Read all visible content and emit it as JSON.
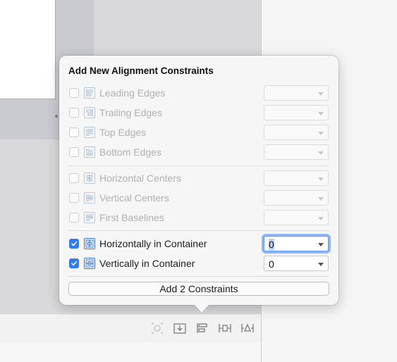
{
  "popover": {
    "title": "Add New Alignment Constraints",
    "add_button_label": "Add 2 Constraints",
    "groups": [
      [
        {
          "label": "Leading Edges",
          "checked": false,
          "icon": "leading-edges-icon"
        },
        {
          "label": "Trailing Edges",
          "checked": false,
          "icon": "trailing-edges-icon"
        },
        {
          "label": "Top Edges",
          "checked": false,
          "icon": "top-edges-icon"
        },
        {
          "label": "Bottom Edges",
          "checked": false,
          "icon": "bottom-edges-icon"
        }
      ],
      [
        {
          "label": "Horizontal Centers",
          "checked": false,
          "icon": "horizontal-centers-icon"
        },
        {
          "label": "Vertical Centers",
          "checked": false,
          "icon": "vertical-centers-icon"
        },
        {
          "label": "First Baselines",
          "checked": false,
          "icon": "first-baselines-icon"
        }
      ],
      [
        {
          "label": "Horizontally in Container",
          "checked": true,
          "icon": "horizontally-in-container-icon",
          "value": "0"
        },
        {
          "label": "Vertically in Container",
          "checked": true,
          "icon": "vertically-in-container-icon",
          "value": "0"
        }
      ]
    ]
  },
  "toolbar": {
    "icons": [
      "update-frames-icon",
      "embed-in-icon",
      "align-icon",
      "add-new-constraints-icon",
      "resolve-issues-icon"
    ]
  },
  "colors": {
    "accent": "#2f7cf6",
    "focus_ring": "#8fb7f7"
  }
}
